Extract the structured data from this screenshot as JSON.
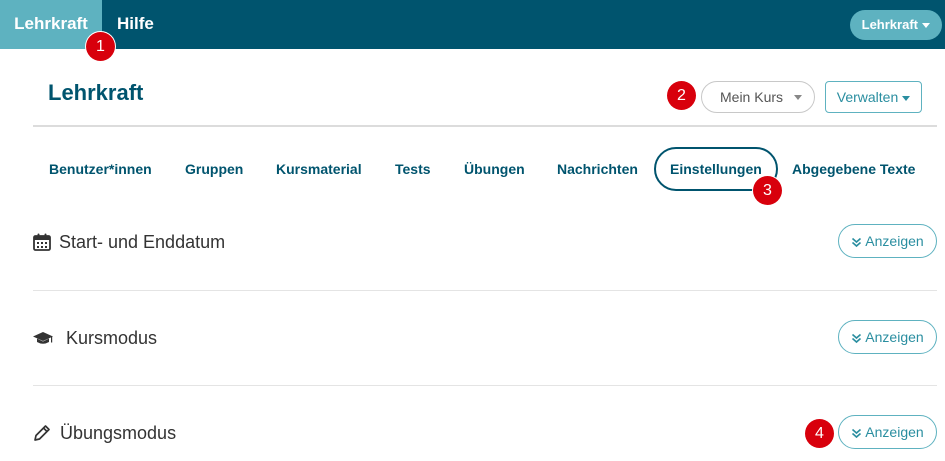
{
  "topbar": {
    "active_item": "Lehrkraft",
    "help_item": "Hilfe",
    "user_menu": "Lehrkraft"
  },
  "badges": [
    "1",
    "2",
    "3",
    "4"
  ],
  "header": {
    "title": "Lehrkraft",
    "course_select": "Mein Kurs",
    "manage_button": "Verwalten"
  },
  "tabs": [
    {
      "label": "Benutzer*innen"
    },
    {
      "label": "Gruppen"
    },
    {
      "label": "Kursmaterial"
    },
    {
      "label": "Tests"
    },
    {
      "label": "Übungen"
    },
    {
      "label": "Nachrichten"
    },
    {
      "label": "Einstellungen",
      "active": true
    },
    {
      "label": "Abgegebene Texte"
    }
  ],
  "sections": [
    {
      "title": "Start- und Enddatum",
      "icon": "calendar-icon",
      "button": "Anzeigen"
    },
    {
      "title": "Kursmodus",
      "icon": "graduation-cap-icon",
      "button": "Anzeigen"
    },
    {
      "title": "Übungsmodus",
      "icon": "pencil-icon",
      "button": "Anzeigen"
    }
  ],
  "colors": {
    "primary": "#00546e",
    "accent": "#5eb2c0",
    "badge": "#d8000c"
  }
}
